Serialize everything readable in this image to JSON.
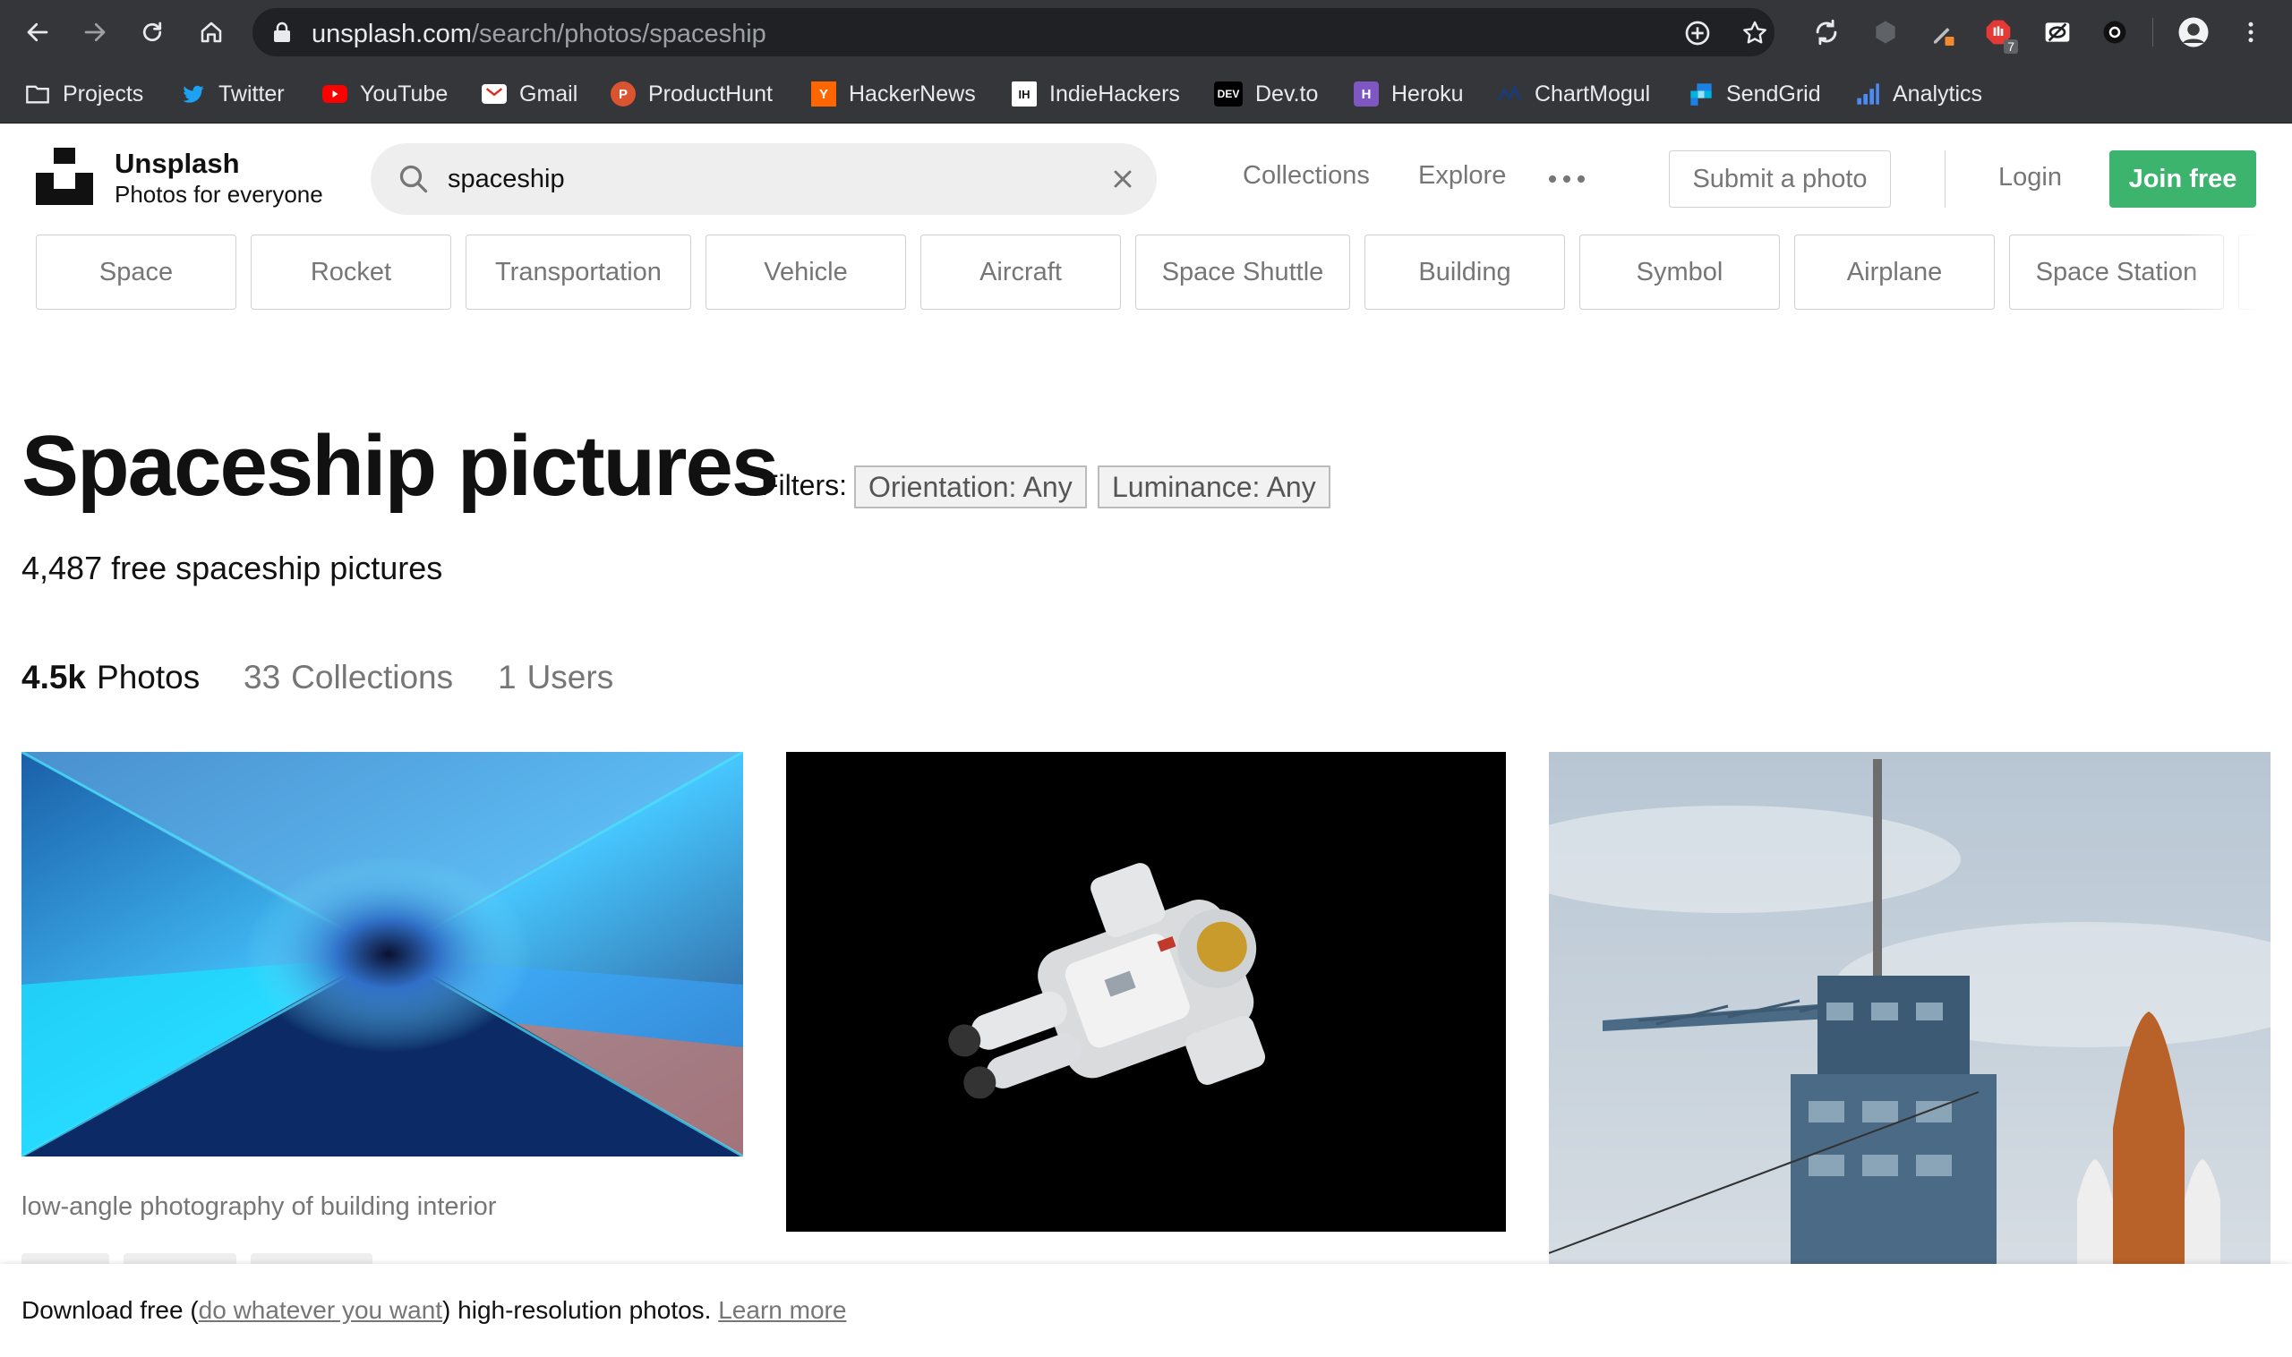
{
  "browser": {
    "url_host": "unsplash.com",
    "url_path": "/search/photos/spaceship",
    "bookmarks": [
      {
        "label": "Projects",
        "icon": "folder-icon"
      },
      {
        "label": "Twitter",
        "icon": "twitter-icon"
      },
      {
        "label": "YouTube",
        "icon": "youtube-icon"
      },
      {
        "label": "Gmail",
        "icon": "gmail-icon"
      },
      {
        "label": "ProductHunt",
        "icon": "producthunt-icon"
      },
      {
        "label": "HackerNews",
        "icon": "hackernews-icon"
      },
      {
        "label": "IndieHackers",
        "icon": "indiehackers-icon"
      },
      {
        "label": "Dev.to",
        "icon": "devto-icon"
      },
      {
        "label": "Heroku",
        "icon": "heroku-icon"
      },
      {
        "label": "ChartMogul",
        "icon": "chartmogul-icon"
      },
      {
        "label": "SendGrid",
        "icon": "sendgrid-icon"
      },
      {
        "label": "Analytics",
        "icon": "analytics-icon"
      }
    ],
    "extension_badge": "7"
  },
  "header": {
    "brand_name": "Unsplash",
    "brand_tagline": "Photos for everyone",
    "search_value": "spaceship",
    "nav_collections": "Collections",
    "nav_explore": "Explore",
    "submit_label": "Submit a photo",
    "login_label": "Login",
    "join_label": "Join free"
  },
  "related": [
    "Space",
    "Rocket",
    "Transportation",
    "Vehicle",
    "Aircraft",
    "Space Shuttle",
    "Building",
    "Symbol",
    "Airplane",
    "Space Station"
  ],
  "main": {
    "title": "Spaceship pictures",
    "filters_label": "Filters:",
    "filter_orientation": "Orientation: Any",
    "filter_luminance": "Luminance: Any",
    "result_count": "4,487 free spaceship pictures",
    "tabs": [
      {
        "count": "4.5k",
        "label": "Photos"
      },
      {
        "count": "33",
        "label": "Collections"
      },
      {
        "count": "1",
        "label": "Users"
      }
    ],
    "photo_caption": "low-angle photography of building interior"
  },
  "banner": {
    "prefix": "Download free (",
    "link1": "do whatever you want",
    "middle": ") high-resolution photos. ",
    "link2": "Learn more"
  },
  "colors": {
    "chrome_bg": "#35363a",
    "join_green": "#3cb46e",
    "muted_text": "#767676"
  }
}
